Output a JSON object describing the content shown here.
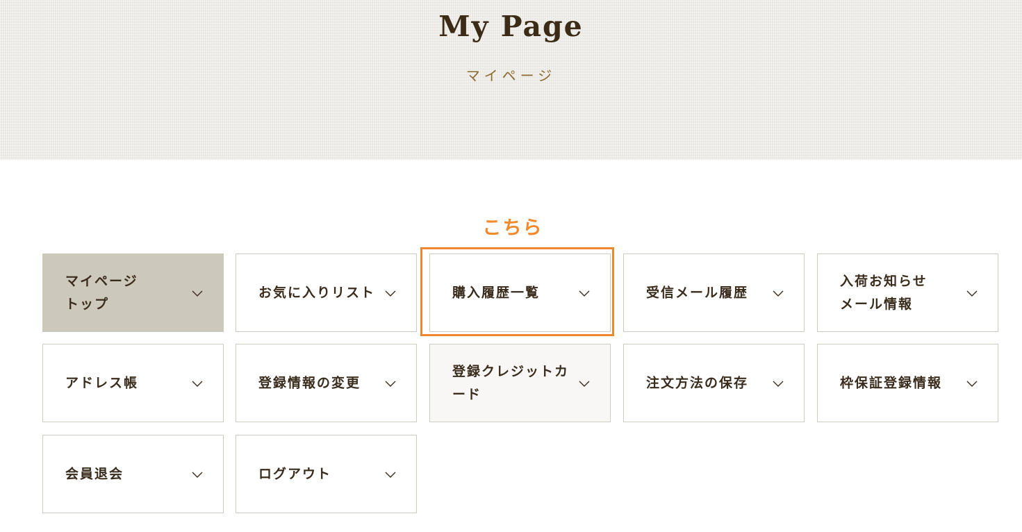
{
  "header": {
    "title": "My Page",
    "subtitle": "マイページ"
  },
  "callout": {
    "label": "こちら",
    "color": "#ef862e"
  },
  "menu": {
    "items": [
      {
        "label": "マイページ\nトップ",
        "state": "active",
        "icon": "chevron-down-icon"
      },
      {
        "label": "お気に入りリスト",
        "state": "normal",
        "icon": "chevron-down-icon"
      },
      {
        "label": "購入履歴一覧",
        "state": "highlighted",
        "icon": "chevron-down-icon"
      },
      {
        "label": "受信メール履歴",
        "state": "normal",
        "icon": "chevron-down-icon"
      },
      {
        "label": "入荷お知らせ\nメール情報",
        "state": "normal",
        "icon": "chevron-down-icon"
      },
      {
        "label": "アドレス帳",
        "state": "normal",
        "icon": "chevron-down-icon"
      },
      {
        "label": "登録情報の変更",
        "state": "normal",
        "icon": "chevron-down-icon"
      },
      {
        "label": "登録クレジットカ\nード",
        "state": "muted",
        "icon": "chevron-down-icon"
      },
      {
        "label": "注文方法の保存",
        "state": "normal",
        "icon": "chevron-down-icon"
      },
      {
        "label": "枠保証登録情報",
        "state": "normal",
        "icon": "chevron-down-icon"
      },
      {
        "label": "会員退会",
        "state": "normal",
        "icon": "chevron-down-icon"
      },
      {
        "label": "ログアウト",
        "state": "normal",
        "icon": "chevron-down-icon"
      }
    ]
  },
  "colors": {
    "active_bg": "#cdc8bc",
    "text": "#3a2c1c",
    "subtitle": "#8a6a2e",
    "hero_bg": "#f1efea"
  }
}
